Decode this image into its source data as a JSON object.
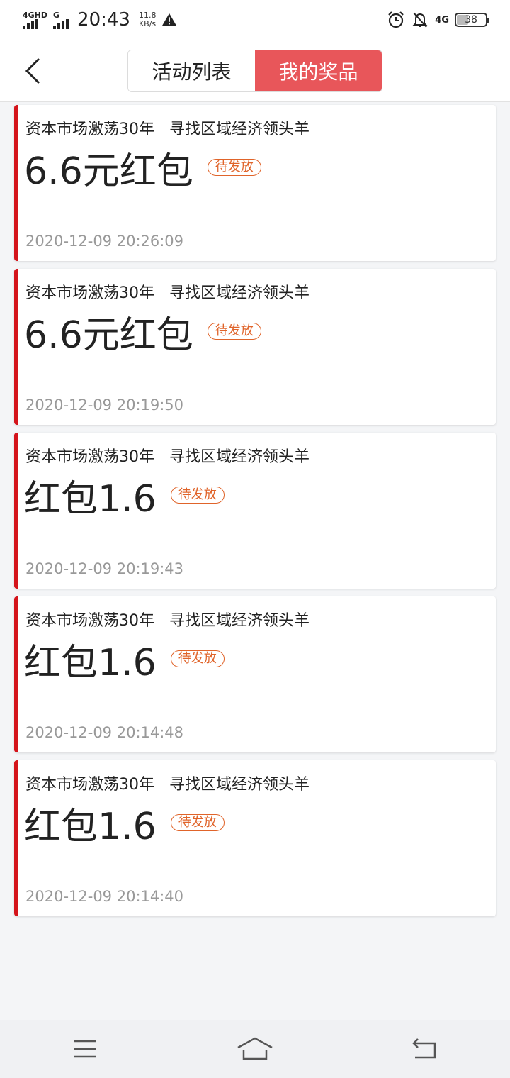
{
  "status_bar": {
    "network1": "4GHD",
    "network2": "G",
    "time": "20:43",
    "speed_value": "11.8",
    "speed_unit": "KB/s",
    "network3": "4G",
    "battery": "38"
  },
  "header": {
    "tabs": [
      {
        "label": "活动列表",
        "active": false
      },
      {
        "label": "我的奖品",
        "active": true
      }
    ]
  },
  "prizes": [
    {
      "title": "资本市场激荡30年   寻找区域经济领头羊",
      "prize": "6.6元红包",
      "status": "待发放",
      "time": "2020-12-09 20:26:09"
    },
    {
      "title": "资本市场激荡30年   寻找区域经济领头羊",
      "prize": "6.6元红包",
      "status": "待发放",
      "time": "2020-12-09 20:19:50"
    },
    {
      "title": "资本市场激荡30年   寻找区域经济领头羊",
      "prize": "红包1.6",
      "status": "待发放",
      "time": "2020-12-09 20:19:43"
    },
    {
      "title": "资本市场激荡30年   寻找区域经济领头羊",
      "prize": "红包1.6",
      "status": "待发放",
      "time": "2020-12-09 20:14:48"
    },
    {
      "title": "资本市场激荡30年   寻找区域经济领头羊",
      "prize": "红包1.6",
      "status": "待发放",
      "time": "2020-12-09 20:14:40"
    }
  ],
  "colors": {
    "accent": "#d4141b",
    "active_tab": "#e8565a",
    "status_badge": "#e0642a"
  }
}
